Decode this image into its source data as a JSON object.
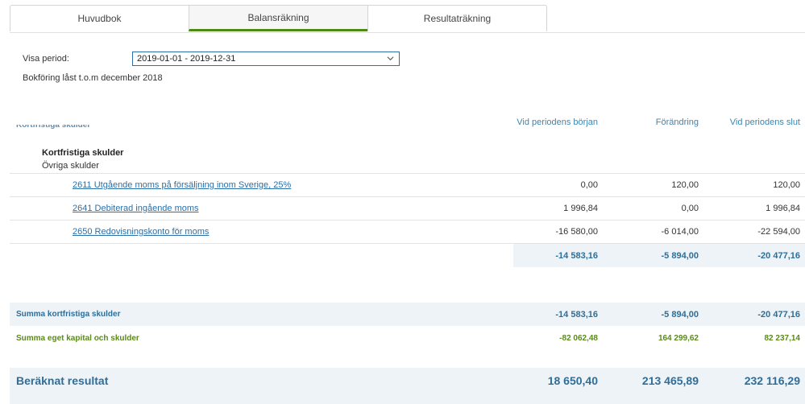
{
  "tabs": [
    {
      "label": "Huvudbok"
    },
    {
      "label": "Balansräkning",
      "active": true
    },
    {
      "label": "Resultaträkning"
    }
  ],
  "filter": {
    "period_label": "Visa period:",
    "period_value": "2019-01-01 - 2019-12-31",
    "locked_text": "Bokföring låst t.o.m december 2018"
  },
  "columns": [
    "Vid periodens början",
    "Förändring",
    "Vid periodens slut"
  ],
  "cut_section_label": "Kortfristiga skulder",
  "group": {
    "title": "Kortfristiga skulder",
    "subtitle": "Övriga skulder"
  },
  "rows": [
    {
      "account": "2611 Utgående moms på försäljning inom Sverige, 25%",
      "start": "0,00",
      "change": "120,00",
      "end": "120,00"
    },
    {
      "account": "2641 Debiterad ingående moms",
      "start": "1 996,84",
      "change": "0,00",
      "end": "1 996,84"
    },
    {
      "account": "2650 Redovisningskonto för moms",
      "start": "-16 580,00",
      "change": "-6 014,00",
      "end": "-22 594,00"
    }
  ],
  "subtotal": {
    "start": "-14 583,16",
    "change": "-5 894,00",
    "end": "-20 477,16"
  },
  "sum_short_term": {
    "label": "Summa kortfristiga skulder",
    "start": "-14 583,16",
    "change": "-5 894,00",
    "end": "-20 477,16"
  },
  "sum_equity": {
    "label": "Summa eget kapital och skulder",
    "start": "-82 062,48",
    "change": "164 299,62",
    "end": "82 237,14"
  },
  "result": {
    "label": "Beräknat resultat",
    "start": "18 650,40",
    "change": "213 465,89",
    "end": "232 116,29"
  },
  "colors": {
    "accent_green": "#4d8a14",
    "link_blue": "#2a6fa8",
    "band": "#edf3f6"
  }
}
